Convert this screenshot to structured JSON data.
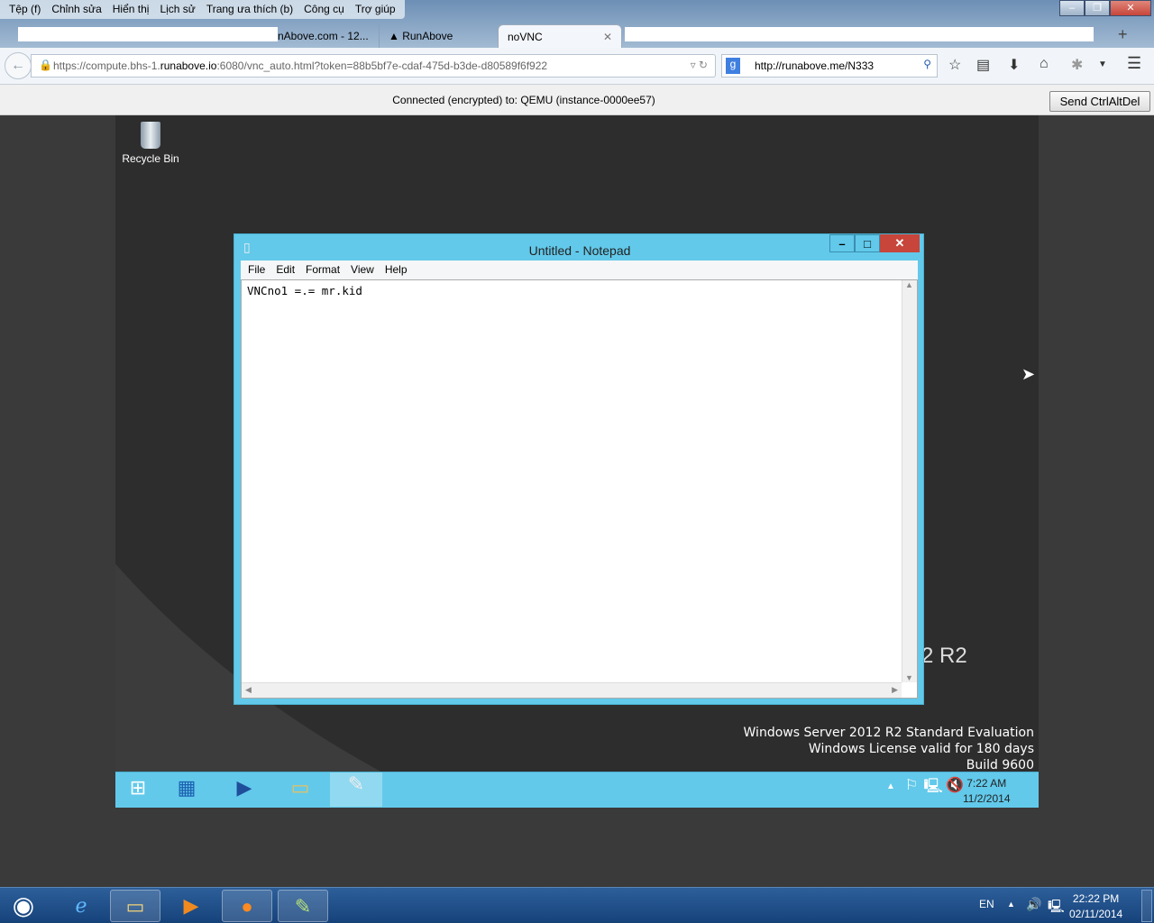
{
  "browser": {
    "menu": [
      "Tệp (f)",
      "Chỉnh sửa",
      "Hiển thị",
      "Lịch sử",
      "Trang ưa thích (b)",
      "Công cụ",
      "Trợ giúp"
    ],
    "tabs": [
      {
        "label": "nAbove.com - 12..."
      },
      {
        "label": "RunAbove"
      },
      {
        "label": "noVNC",
        "active": true
      }
    ],
    "new_tab": "+",
    "url_prefix": "https://compute.bhs-1.",
    "url_host": "runabove.io",
    "url_rest": ":6080/vnc_auto.html?token=88b5bf7e-cdaf-475d-b3de-d80589f6f922",
    "search_value": "http://runabove.me/N333"
  },
  "novnc": {
    "status": "Connected (encrypted) to: QEMU (instance-0000ee57)",
    "send_ctrlaltdel": "Send CtrlAltDel"
  },
  "remote": {
    "recycle_bin": "Recycle Bin",
    "r2_fragment": "2 R2",
    "watermark": [
      "Windows Server 2012 R2 Standard Evaluation",
      "Windows License valid for 180 days",
      "Build 9600"
    ],
    "clock_time": "7:22 AM",
    "clock_date": "11/2/2014"
  },
  "notepad": {
    "title": "Untitled - Notepad",
    "menu": [
      "File",
      "Edit",
      "Format",
      "View",
      "Help"
    ],
    "content": "VNCno1 =.= mr.kid"
  },
  "host_taskbar": {
    "lang": "EN",
    "clock_time": "22:22 PM",
    "clock_date": "02/11/2014"
  },
  "colors": {
    "win8_accent": "#62c9ea",
    "close_red": "#c7453a"
  }
}
